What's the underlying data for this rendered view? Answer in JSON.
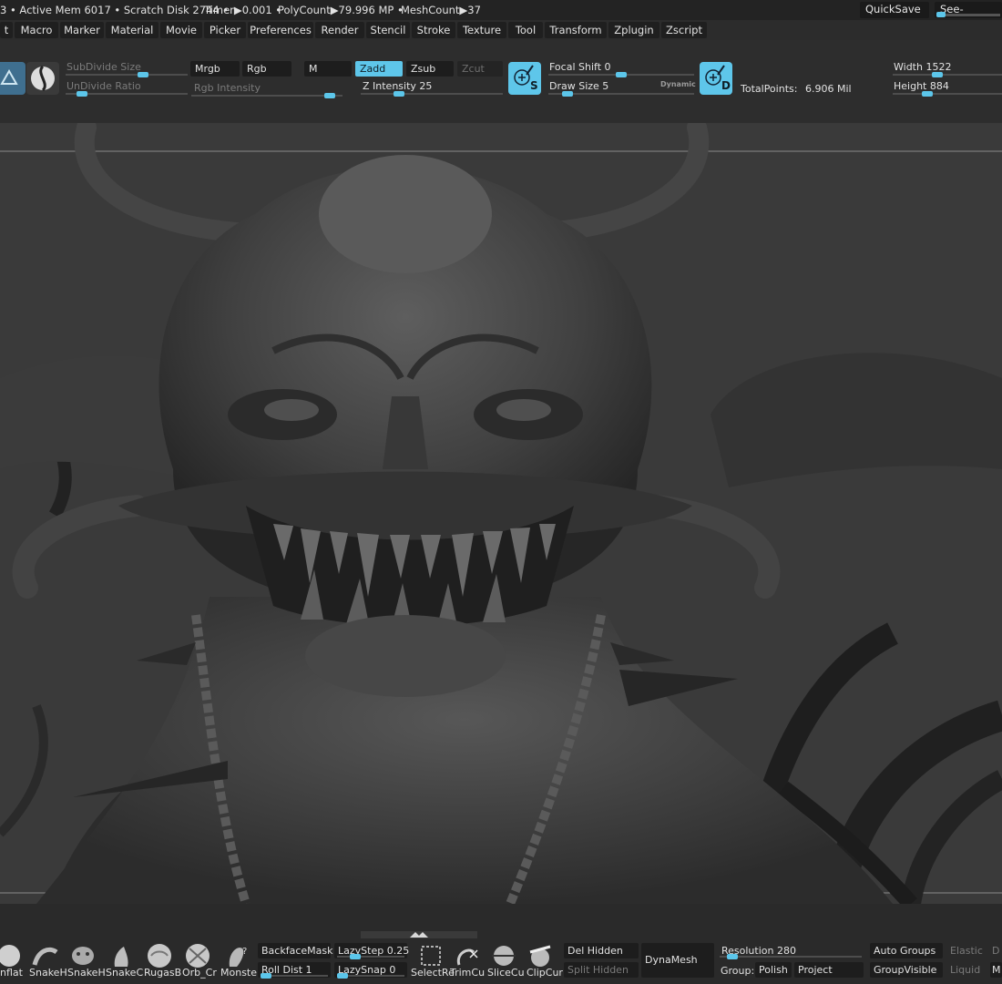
{
  "status": {
    "active_mem": "3 • Active Mem 6017 • Scratch Disk 2744 •",
    "timer": "Timer▶0.001 •",
    "polycount": "PolyCount▶79.996 MP •",
    "meshcount": "MeshCount▶37",
    "quicksave": "QuickSave",
    "see_through": "See-through"
  },
  "menus": [
    "t",
    "Macro",
    "Marker",
    "Material",
    "Movie",
    "Picker",
    "Preferences",
    "Render",
    "Stencil",
    "Stroke",
    "Texture",
    "Tool",
    "Transform",
    "Zplugin",
    "Zscript"
  ],
  "shelf": {
    "subdivide_size": "SubDivide Size",
    "undivide_ratio": "UnDivide Ratio",
    "mrgb": "Mrgb",
    "rgb": "Rgb",
    "rgb_intensity": "Rgb Intensity",
    "m": "M",
    "zadd": "Zadd",
    "zsub": "Zsub",
    "zcut": "Zcut",
    "z_intensity": "Z Intensity 25",
    "focal_shift": "Focal Shift 0",
    "draw_size": "Draw Size 5",
    "dynamic": "Dynamic",
    "total_points_label": "TotalPoints:",
    "total_points_value": "6.906 Mil",
    "width": "Width 1522",
    "height": "Height 884",
    "s_letter": "S",
    "d_letter": "D"
  },
  "levels": {
    "subdivide_size": 0.65,
    "undivide_ratio": 0.1,
    "rgb_intensity": 0.95,
    "z_intensity": 0.25,
    "focal_shift": 0.5,
    "draw_size": 0.1,
    "width": 0.4,
    "height": 0.3,
    "see_through": 0.0
  },
  "bottom": {
    "brushes": [
      "nflat",
      "SnakeH",
      "SnakeH",
      "SnakeC",
      "RugasB",
      "Orb_Cr",
      "Monste"
    ],
    "backface_mask": "BackfaceMask",
    "roll_dist": "Roll Dist 1",
    "lazy_step": "LazyStep 0.25",
    "lazy_snap": "LazySnap 0",
    "selectr": "SelectRe",
    "trimcu": "TrimCu",
    "slicecu": "SliceCu",
    "clipcur": "ClipCur",
    "del_hidden": "Del Hidden",
    "split_hidden": "Split Hidden",
    "dynamesh": "DynaMesh",
    "resolution": "Resolution 280",
    "group": "Group:",
    "polish": "Polish",
    "project": "Project",
    "auto_groups": "Auto Groups",
    "group_visible": "GroupVisible",
    "elastic": "Elastic",
    "liquid": "Liquid",
    "d": "D",
    "m": "M"
  },
  "colors": {
    "accent": "#5cc6ea",
    "background": "#2a2a2a",
    "viewport": "#3a3a3a",
    "sculpt": "#4a4a4a"
  }
}
